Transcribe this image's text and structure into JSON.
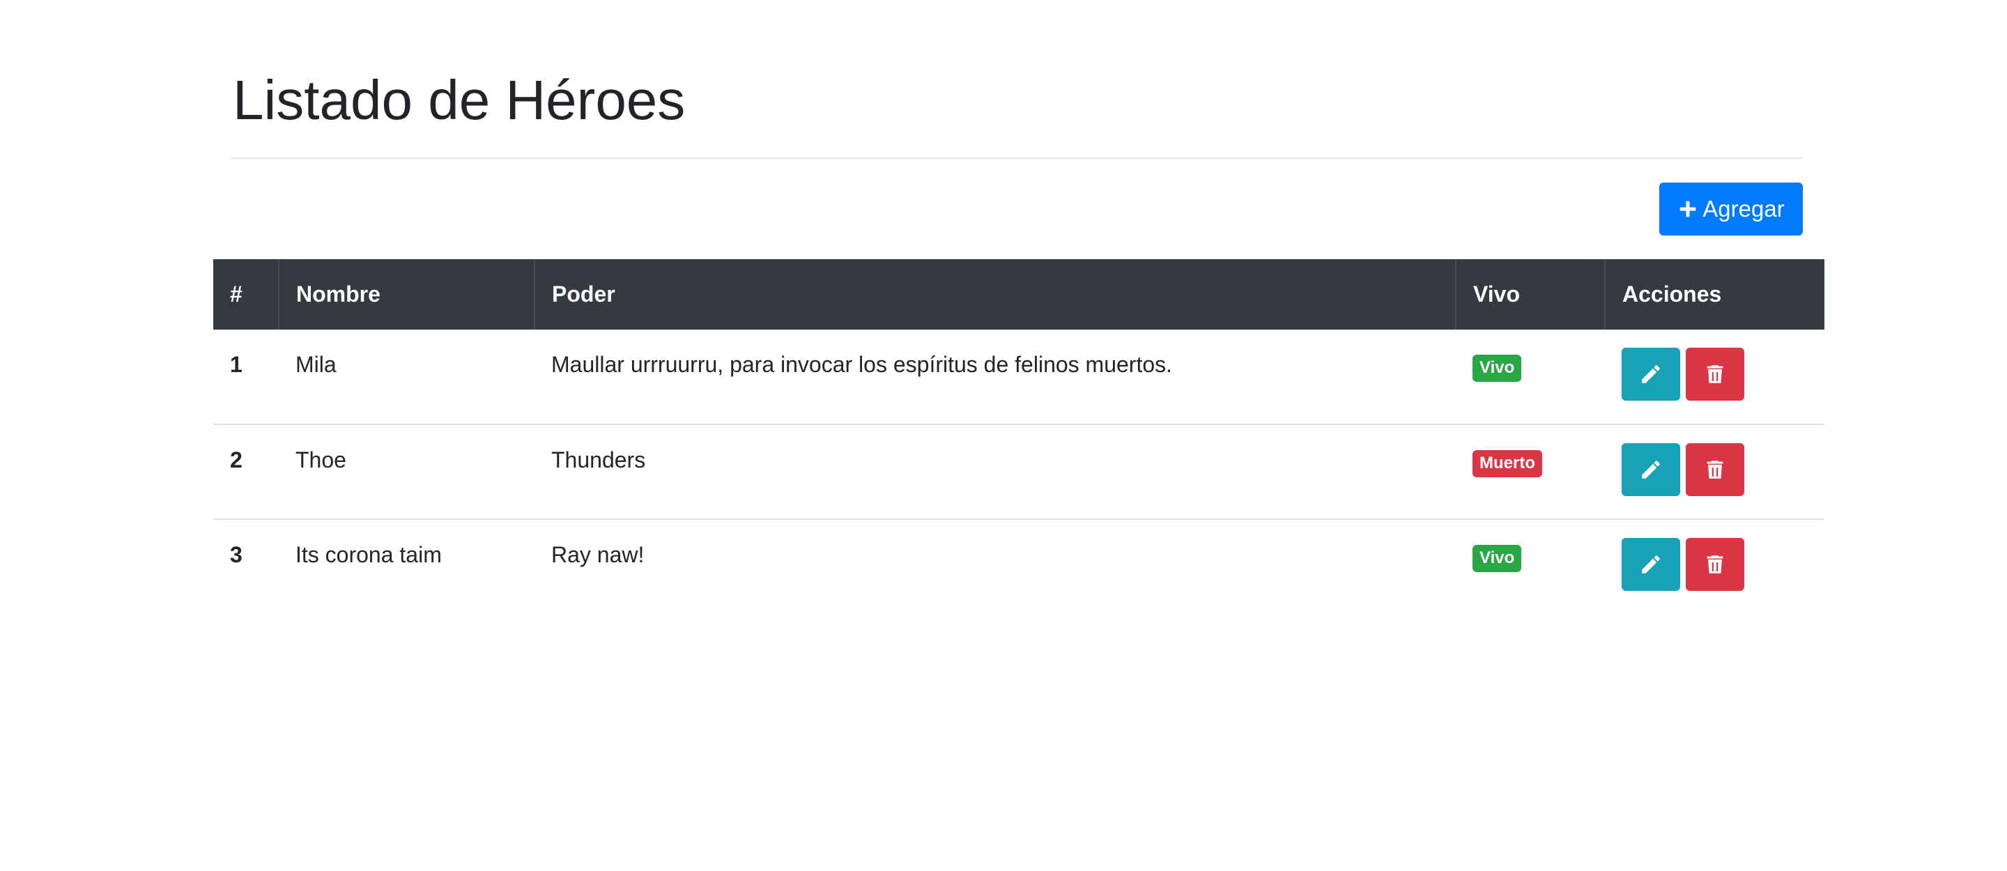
{
  "page": {
    "title": "Listado de Héroes"
  },
  "toolbar": {
    "add_label": "Agregar",
    "add_icon": "plus-icon"
  },
  "table": {
    "headers": [
      "#",
      "Nombre",
      "Poder",
      "Vivo",
      "Acciones"
    ],
    "rows": [
      {
        "num": "1",
        "name": "Mila",
        "power": "Maullar urrruurru, para invocar los espíritus de felinos muertos.",
        "status": "Vivo",
        "status_color": "#28a745"
      },
      {
        "num": "2",
        "name": "Thoe",
        "power": "Thunders",
        "status": "Muerto",
        "status_color": "#dc3545"
      },
      {
        "num": "3",
        "name": "Its corona taim",
        "power": "Ray naw!",
        "status": "Vivo",
        "status_color": "#28a745"
      }
    ],
    "row_actions": {
      "edit_icon": "pencil-icon",
      "delete_icon": "trash-icon"
    }
  },
  "colors": {
    "primary": "#007bff",
    "info": "#17a2b8",
    "danger": "#dc3545",
    "success": "#28a745",
    "header_dark": "#343a40"
  }
}
